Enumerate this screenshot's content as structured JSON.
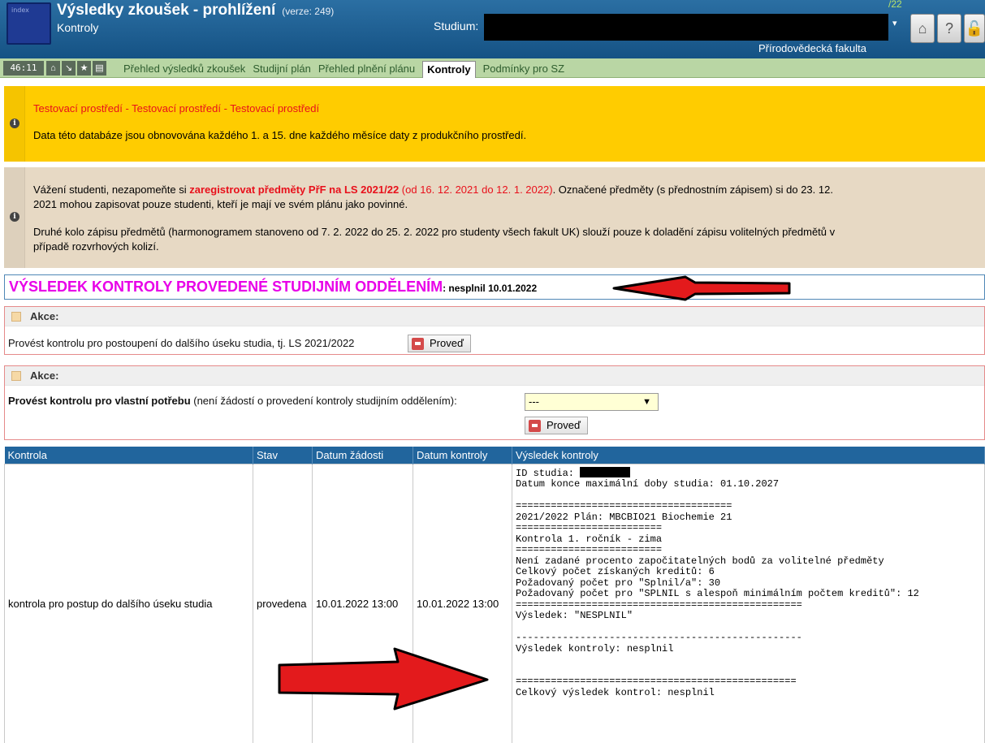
{
  "header": {
    "logo_text": "index",
    "title": "Výsledky zkoušek - prohlížení",
    "version": "(verze: 249)",
    "subtitle": "Kontroly",
    "studium_label": "Studium:",
    "studium_fragment": "/22",
    "faculty": "Přírodovědecká fakulta",
    "icons": [
      "home-icon",
      "help-icon",
      "lock-icon"
    ]
  },
  "nav": {
    "timer": "46:11",
    "items": [
      "Přehled výsledků zkoušek",
      "Studijní plán",
      "Přehled plnění plánu",
      "Kontroly",
      "Podmínky pro SZ"
    ],
    "active": "Kontroly"
  },
  "notice_test": {
    "title": "Testovací prostředí - Testovací prostředí - Testovací prostředí",
    "text": "Data této databáze jsou obnovována každého 1. a 15. dne každého měsíce daty z produkčního prostředí."
  },
  "notice_students": {
    "p1_pre": "Vážení studenti, nezapomeňte si ",
    "p1_link": "zaregistrovat předměty PřF na LS 2021/22",
    "p1_dates": " (od 16. 12. 2021 do 12. 1. 2022)",
    "p1_post": ". Označené předměty (s přednostním zápisem) si do 23. 12.",
    "p1_line2": "2021 mohou zapisovat pouze studenti, kteří je mají ve svém plánu jako povinné.",
    "p2_line1": "Druhé kolo zápisu předmětů (harmonogramem stanoveno od 7. 2. 2022 do 25. 2. 2022 pro studenty všech fakult UK) slouží pouze k doladění zápisu volitelných předmětů v",
    "p2_line2": "případě rozvrhových kolizí."
  },
  "result": {
    "title": "VÝSLEDEK KONTROLY PROVEDENÉ STUDIJNÍM ODDĚLENÍM",
    "value": ": nesplnil 10.01.2022"
  },
  "akce1": {
    "head": "Akce:",
    "text": "Provést kontrolu pro postoupení do dalšího úseku studia, tj. LS 2021/2022",
    "button": "Proveď"
  },
  "akce2": {
    "head": "Akce:",
    "text_bold": "Provést kontrolu pro vlastní potřebu",
    "text_rest": " (není žádostí o provedení kontroly studijním oddělením):",
    "select_value": "---",
    "button": "Proveď"
  },
  "table": {
    "columns": [
      "Kontrola",
      "Stav",
      "Datum žádosti",
      "Datum kontroly",
      "Výsledek kontroly"
    ],
    "row": {
      "kontrola": "kontrola pro postup do dalšího úseku studia",
      "stav": "provedena",
      "datum_zadosti": "10.01.2022 13:00",
      "datum_kontroly": "10.01.2022 13:00",
      "result_id_label": "ID studia: ",
      "result_lines": "Datum konce maximální doby studia: 01.10.2027\n\n=====================================\n2021/2022 Plán: MBCBIO21 Biochemie 21\n=========================\nKontrola 1. ročník - zima\n=========================\nNení zadané procento započitatelných bodů za volitelné předměty\nCelkový počet získaných kreditů: 6\nPožadovaný počet pro \"Splnil/a\": 30\nPožadovaný počet pro \"SPLNIL s alespoň minimálním počtem kreditů\": 12\n=================================================\nVýsledek: \"NESPLNIL\"\n\n-------------------------------------------------\nVýsledek kontroly: nesplnil\n\n\n================================================\nCelkový výsledek kontrol: nesplnil"
    }
  }
}
